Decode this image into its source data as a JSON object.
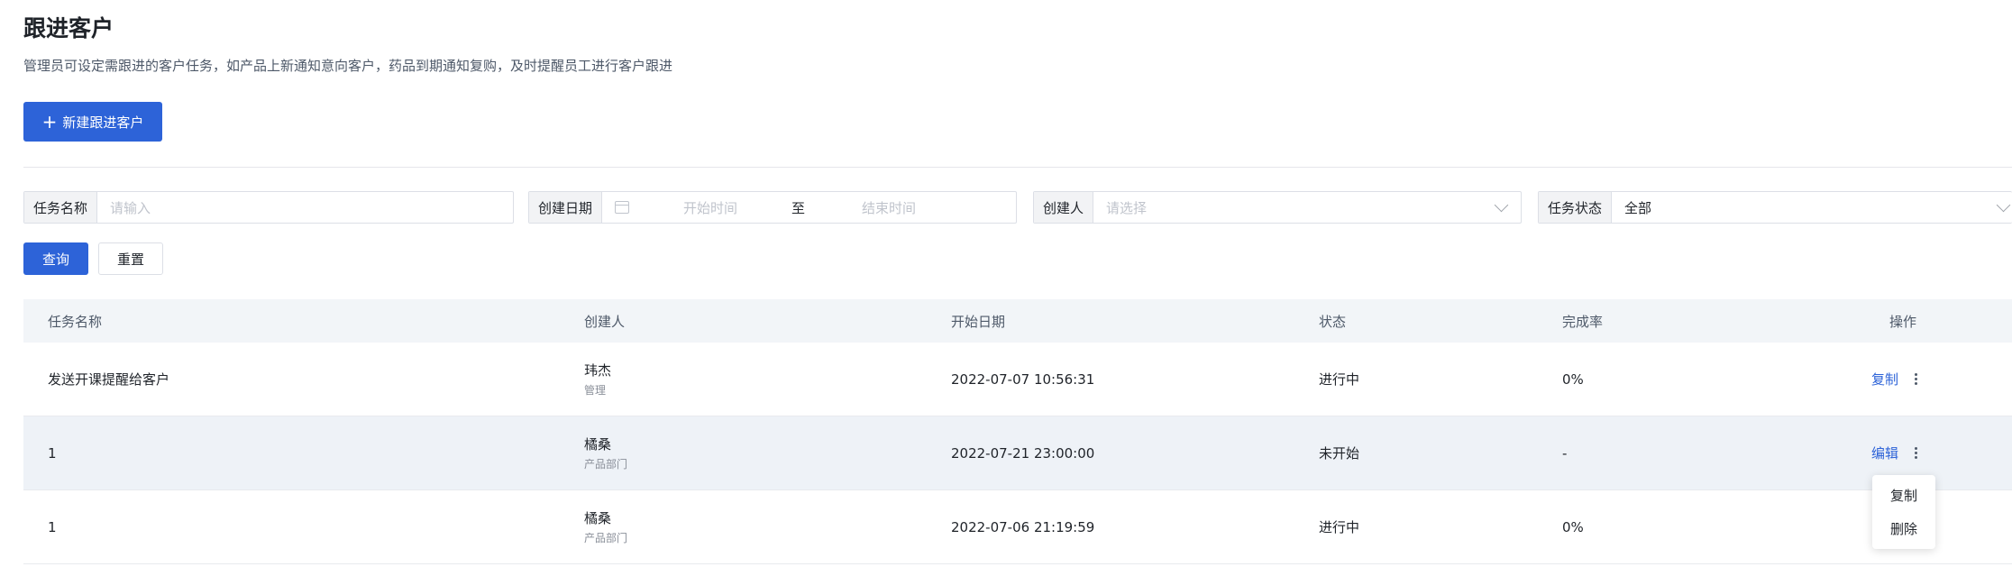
{
  "header": {
    "title": "跟进客户",
    "description": "管理员可设定需跟进的客户任务，如产品上新通知意向客户，药品到期通知复购，及时提醒员工进行客户跟进",
    "new_button_label": "新建跟进客户"
  },
  "filters": {
    "task_name": {
      "label": "任务名称",
      "placeholder": "请输入"
    },
    "create_date": {
      "label": "创建日期",
      "start_placeholder": "开始时间",
      "separator": "至",
      "end_placeholder": "结束时间"
    },
    "creator": {
      "label": "创建人",
      "placeholder": "请选择"
    },
    "status": {
      "label": "任务状态",
      "value": "全部"
    },
    "query_label": "查询",
    "reset_label": "重置"
  },
  "table": {
    "columns": [
      "任务名称",
      "创建人",
      "开始日期",
      "状态",
      "完成率",
      "操作"
    ],
    "rows": [
      {
        "name": "发送开课提醒给客户",
        "creator_name": "玮杰",
        "creator_dept": "管理",
        "start": "2022-07-07 10:56:31",
        "status": "进行中",
        "rate": "0%",
        "action": "复制"
      },
      {
        "name": "1",
        "creator_name": "橘桑",
        "creator_dept": "产品部门",
        "start": "2022-07-21 23:00:00",
        "status": "未开始",
        "rate": "-",
        "action": "编辑"
      },
      {
        "name": "1",
        "creator_name": "橘桑",
        "creator_dept": "产品部门",
        "start": "2022-07-06 21:19:59",
        "status": "进行中",
        "rate": "0%",
        "action": ""
      }
    ]
  },
  "dropdown_menu": {
    "items": [
      "复制",
      "删除"
    ]
  },
  "icons": {
    "new": "plus-icon",
    "calendar": "calendar-icon",
    "select": "chevron-down-icon",
    "more": "more-vertical-icon"
  },
  "colors": {
    "primary": "#2d63d8",
    "header_bg": "#f2f5f8",
    "highlight_row": "#eef2f7"
  }
}
